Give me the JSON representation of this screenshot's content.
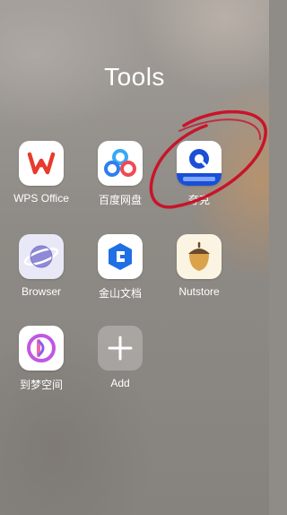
{
  "folder": {
    "title": "Tools"
  },
  "apps": [
    {
      "label": "WPS Office",
      "icon": "wps-office-icon"
    },
    {
      "label": "百度网盘",
      "icon": "baidu-netdisk-icon"
    },
    {
      "label": "夸克",
      "icon": "quark-icon"
    },
    {
      "label": "Browser",
      "icon": "browser-planet-icon"
    },
    {
      "label": "金山文档",
      "icon": "kingsoft-docs-icon"
    },
    {
      "label": "Nutstore",
      "icon": "nutstore-acorn-icon"
    },
    {
      "label": "到梦空间",
      "icon": "daomeng-space-icon"
    },
    {
      "label": "Add",
      "icon": "plus-icon"
    }
  ],
  "colors": {
    "wps_red": "#e63b2e",
    "quark_blue": "#1a4fd6",
    "annotation_red": "#c8142a"
  }
}
